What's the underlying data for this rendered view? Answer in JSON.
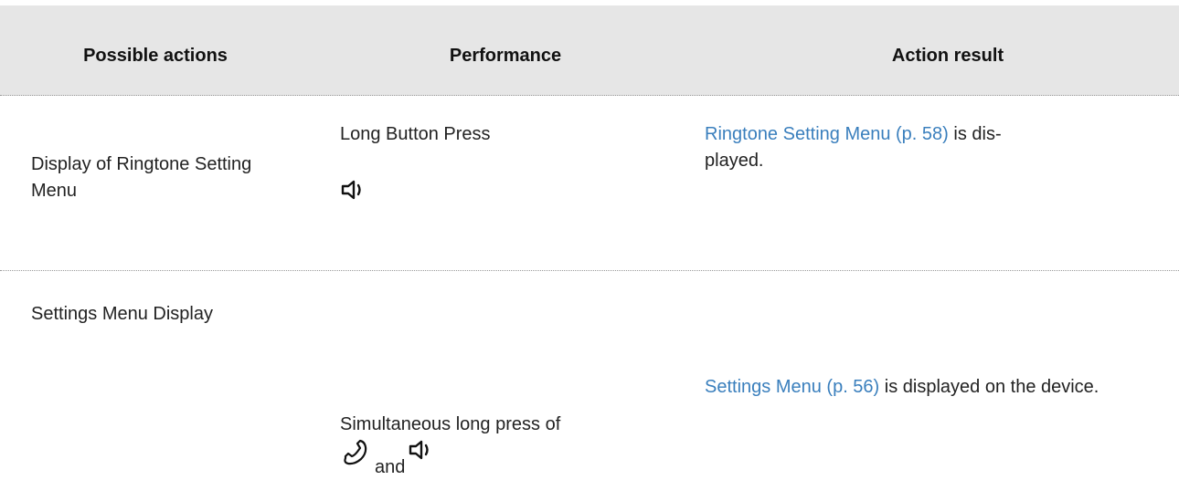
{
  "header": {
    "col1": "Possible actions",
    "col2": "Performance",
    "col3": "Action result"
  },
  "rows": [
    {
      "action": "Display of Ringtone Setting Menu",
      "performance": "Long Button Press",
      "performance_icons": [
        "speaker-icon"
      ],
      "result_link": "Ringtone Setting Menu (p. 58)",
      "result_text": " is dis-played."
    },
    {
      "action": "Settings Menu Display",
      "performance": "Simultaneous long press of",
      "performance_icons": [
        "handset-icon",
        "speaker-icon"
      ],
      "connector": "and",
      "result_link": "Settings Menu (p. 56)",
      "result_text": " is displayed on the device."
    }
  ],
  "colors": {
    "header_bg": "#e6e6e6",
    "link": "#3a7fbd",
    "text": "#222222"
  }
}
